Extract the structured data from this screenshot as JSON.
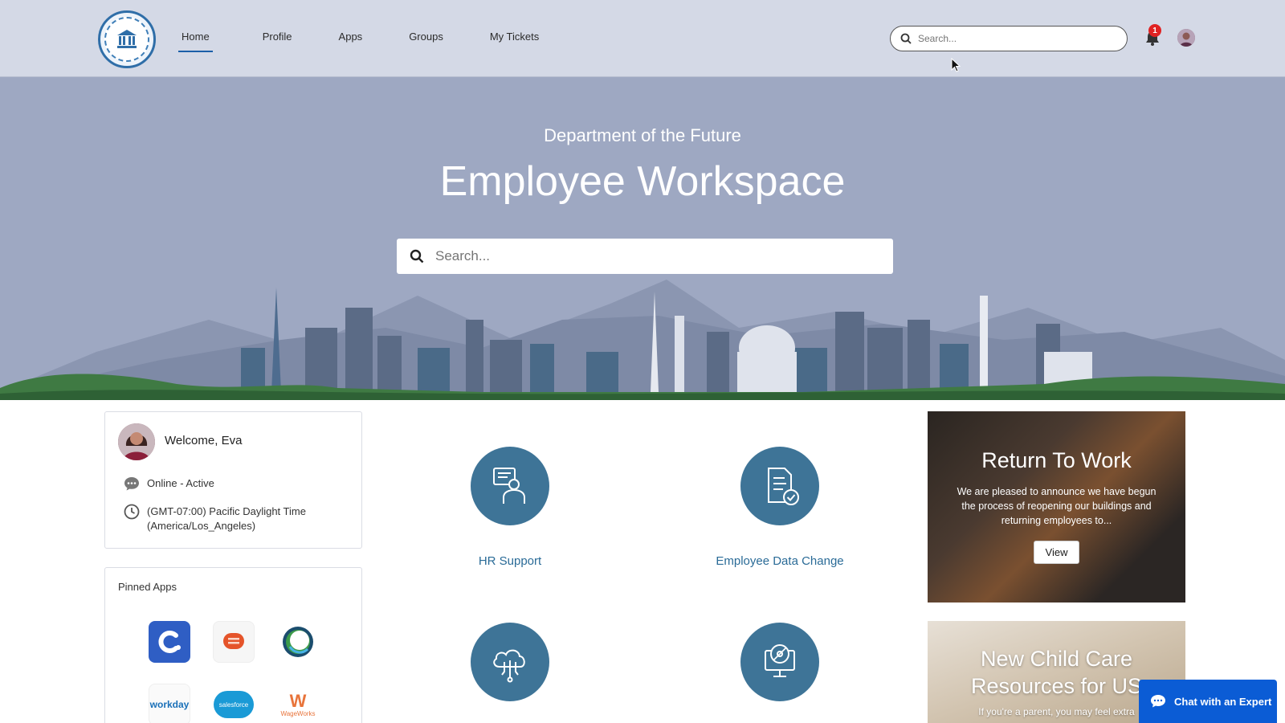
{
  "nav": {
    "items": [
      {
        "label": "Home",
        "active": true
      },
      {
        "label": "Profile",
        "active": false
      },
      {
        "label": "Apps",
        "active": false
      },
      {
        "label": "Groups",
        "active": false
      },
      {
        "label": "My Tickets",
        "active": false
      }
    ]
  },
  "header": {
    "search_placeholder": "Search...",
    "notification_count": "1"
  },
  "hero": {
    "subtitle": "Department of the Future",
    "title": "Employee Workspace",
    "search_placeholder": "Search..."
  },
  "welcome": {
    "greeting": "Welcome, Eva",
    "status": "Online - Active",
    "timezone_line1": "(GMT-07:00) Pacific Daylight Time",
    "timezone_line2": "(America/Los_Angeles)"
  },
  "pinned_apps": {
    "title": "Pinned Apps",
    "apps": [
      "c-app-icon",
      "chat-app-icon",
      "ring-app-icon",
      "workday",
      "salesforce",
      "WageWorks"
    ]
  },
  "tiles": [
    {
      "label": "HR Support",
      "icon": "hr-support-icon"
    },
    {
      "label": "Employee Data Change",
      "icon": "document-check-icon"
    },
    {
      "label": "",
      "icon": "cloud-network-icon"
    },
    {
      "label": "",
      "icon": "monitor-disc-icon"
    }
  ],
  "promos": [
    {
      "title": "Return To Work",
      "text": "We are pleased to announce we have begun the process of reopening our buildings and returning employees to...",
      "button": "View"
    },
    {
      "title": "New Child Care Resources for US",
      "text": "If you're a parent, you may feel extra"
    }
  ],
  "chat": {
    "label": "Chat with an Expert"
  },
  "colors": {
    "header_bg": "#d4d9e6",
    "hero_bg": "#9ea8c2",
    "tile_circle": "#3e7497",
    "link": "#2a6b97",
    "chat_button": "#0b5cd5"
  }
}
